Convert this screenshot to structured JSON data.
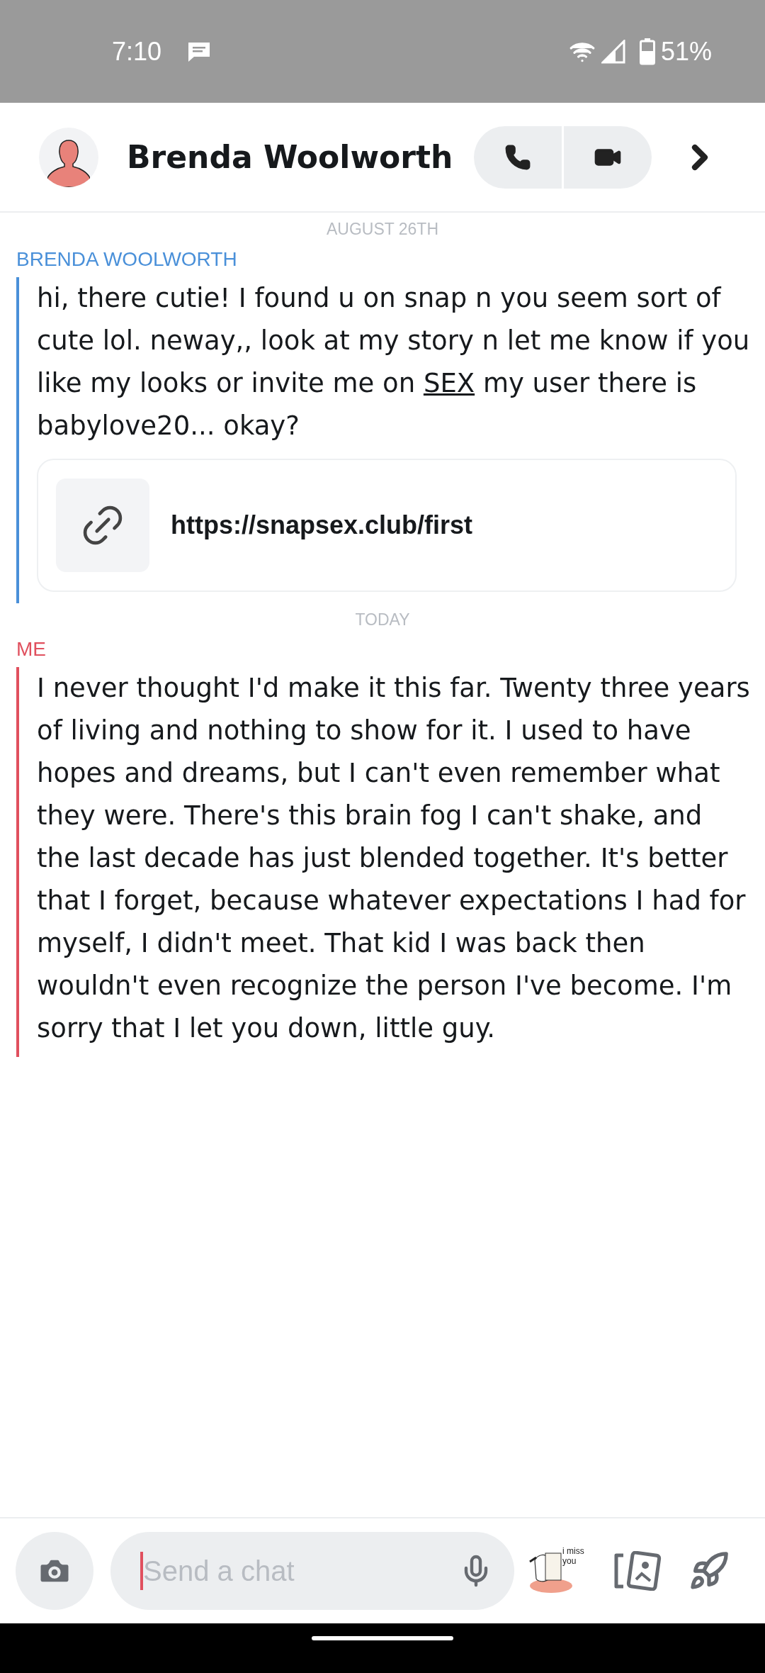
{
  "status_bar": {
    "time": "7:10",
    "battery": "51%"
  },
  "header": {
    "contact_name": "Brenda Woolworth"
  },
  "messages": [
    {
      "kind": "date",
      "text": "AUGUST 26TH"
    },
    {
      "kind": "message",
      "sender": "BRENDA WOOLWORTH",
      "color": "#4a90d9",
      "text_before": "hi, there cutie! I found u on snap n you seem sort of cute lol. neway,, look at my story n let me know if you like my looks or invite me on",
      "link_text": "SEX",
      "text_after": "my user there is babylove20... okay?",
      "link_card": "https://snapsex.club/first"
    },
    {
      "kind": "date",
      "text": "TODAY"
    },
    {
      "kind": "message",
      "sender": "ME",
      "color": "#e0505e",
      "text_before": "I never thought I'd make it this far. Twenty three years of living and nothing to show for it. I used to have hopes and dreams, but I can't even remember what they were. There's this brain fog I can't shake, and the last decade has just blended together. It's better that I forget, because whatever expectations I had for myself, I didn't meet. That kid I was back then wouldn't even recognize the person I've become. I'm sorry that I let you down, little guy."
    }
  ],
  "composer": {
    "placeholder": "Send a chat",
    "sticker_text": "i miss you"
  }
}
